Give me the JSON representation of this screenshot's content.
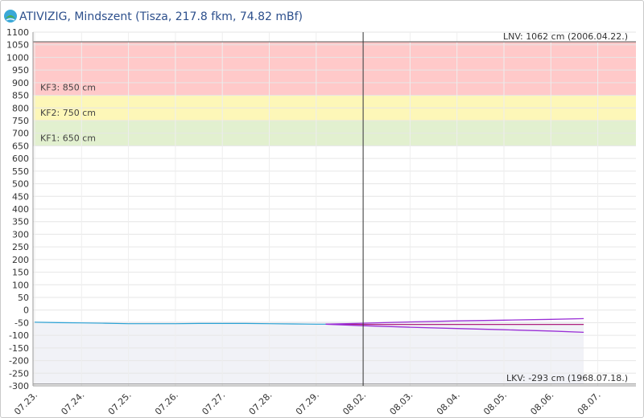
{
  "header": {
    "title": "ATIVIZIG, Mindszent (Tisza, 217.8 fkm, 74.82 mBf)",
    "logo_icon": "water-drop-leaf-logo"
  },
  "chart_data": {
    "type": "line",
    "title": "ATIVIZIG, Mindszent (Tisza, 217.8 fkm, 74.82 mBf)",
    "ylim": [
      -300,
      1100
    ],
    "y_ticks": [
      1100,
      1050,
      1000,
      950,
      900,
      850,
      800,
      750,
      700,
      650,
      600,
      550,
      500,
      450,
      400,
      350,
      300,
      250,
      200,
      150,
      100,
      50,
      0,
      -50,
      -100,
      -150,
      -200,
      -250,
      -300
    ],
    "x_ticks": [
      "07.23.",
      "07.24.",
      "07.25.",
      "07.26.",
      "07.27.",
      "07.28.",
      "07.29.",
      "08.02.",
      "08.03.",
      "08.04.",
      "08.05.",
      "08.06.",
      "08.07."
    ],
    "grid": true,
    "bands": [
      {
        "name": "KF3",
        "label": "KF3: 850 cm",
        "from": 850,
        "to": 1062,
        "color": "#ffc9c9"
      },
      {
        "name": "KF2",
        "label": "KF2: 750 cm",
        "from": 750,
        "to": 850,
        "color": "#fdf7b8"
      },
      {
        "name": "KF1",
        "label": "KF1: 650 cm",
        "from": 650,
        "to": 750,
        "color": "#e2f0cf"
      }
    ],
    "reference_lines": [
      {
        "name": "LNV",
        "label": "LNV: 1062 cm (2006.04.22.)",
        "value": 1062,
        "color": "#555555"
      },
      {
        "name": "LKV",
        "label": "LKV: -293 cm (1968.07.18.)",
        "value": -293,
        "color": "#888888"
      }
    ],
    "current_marker_x": 7,
    "series": [
      {
        "role": "measured",
        "color": "#2aa3d6",
        "points": [
          [
            0,
            -48
          ],
          [
            0.5,
            -50
          ],
          [
            1,
            -51
          ],
          [
            1.5,
            -52
          ],
          [
            2,
            -54
          ],
          [
            2.5,
            -54
          ],
          [
            3,
            -54
          ],
          [
            3.5,
            -53
          ],
          [
            4,
            -53
          ],
          [
            4.5,
            -53
          ],
          [
            5,
            -54
          ],
          [
            5.5,
            -55
          ],
          [
            6,
            -56
          ],
          [
            6.2,
            -56
          ]
        ]
      },
      {
        "role": "forecast",
        "color": "#b0217e",
        "points": [
          [
            6.2,
            -56
          ],
          [
            7,
            -57
          ],
          [
            8,
            -57
          ],
          [
            9,
            -57
          ],
          [
            10,
            -57
          ],
          [
            11,
            -57
          ],
          [
            11.7,
            -57
          ]
        ]
      },
      {
        "role": "forecast-upper",
        "color": "#9a2fd6",
        "points": [
          [
            6.2,
            -56
          ],
          [
            7,
            -52
          ],
          [
            8,
            -47
          ],
          [
            9,
            -43
          ],
          [
            10,
            -40
          ],
          [
            11,
            -37
          ],
          [
            11.7,
            -34
          ]
        ]
      },
      {
        "role": "forecast-lower",
        "color": "#9a2fd6",
        "points": [
          [
            6.2,
            -56
          ],
          [
            7,
            -62
          ],
          [
            8,
            -68
          ],
          [
            9,
            -73
          ],
          [
            10,
            -78
          ],
          [
            11,
            -83
          ],
          [
            11.7,
            -88
          ]
        ]
      }
    ]
  }
}
